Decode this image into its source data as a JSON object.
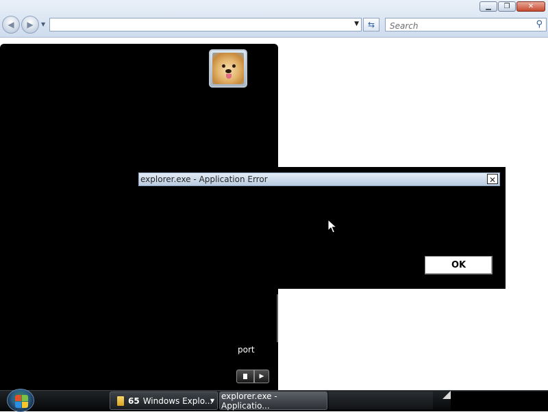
{
  "explorer_toolbar": {
    "address_value": "",
    "search_placeholder": "Search"
  },
  "start_panel": {
    "visible_item_label": "port"
  },
  "error_dialog": {
    "title": "explorer.exe - Application Error",
    "close_glyph": "✕",
    "ok_label": "OK"
  },
  "taskbar": {
    "items": [
      {
        "count": "65",
        "label": "Windows Explo..."
      },
      {
        "label": "explorer.exe - Applicatio..."
      }
    ]
  },
  "colors": {
    "toolbar_bg": "#dbe6f3",
    "panel_bg": "#000000",
    "dialog_title_bg": "#cfdcee"
  }
}
